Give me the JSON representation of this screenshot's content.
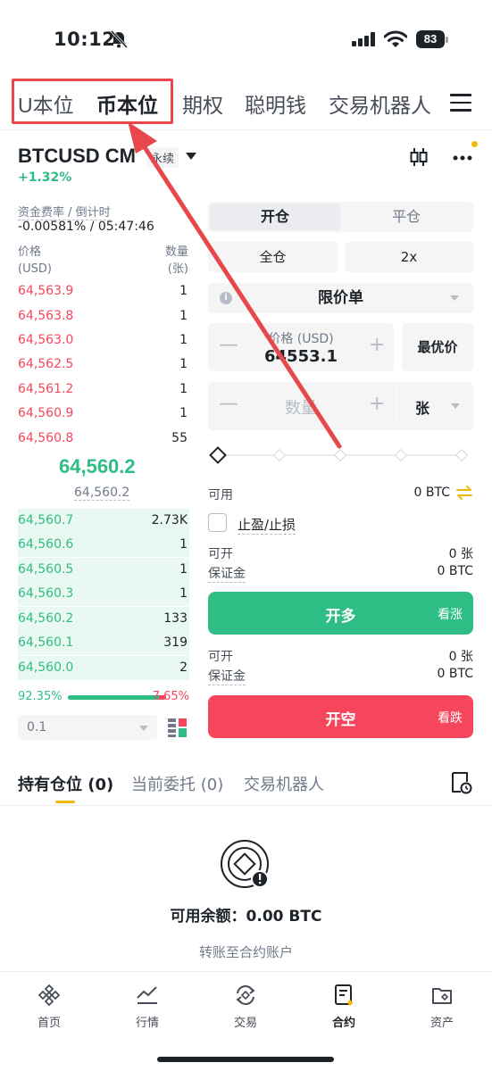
{
  "status_bar": {
    "time": "10:12",
    "battery": "83"
  },
  "top_tabs": [
    "U本位",
    "币本位",
    "期权",
    "聪明钱",
    "交易机器人"
  ],
  "symbol": {
    "name": "BTCUSD CM",
    "badge": "永续",
    "change": "+1.32%"
  },
  "orderbook": {
    "funding_label": "资金费率 / 倒计时",
    "funding_value": "-0.00581% / 05:47:46",
    "price_header": [
      "价格",
      "(USD)"
    ],
    "qty_header": [
      "数量",
      "(张)"
    ],
    "asks": [
      {
        "price": "64,563.9",
        "qty": "1"
      },
      {
        "price": "64,563.8",
        "qty": "1"
      },
      {
        "price": "64,563.0",
        "qty": "1"
      },
      {
        "price": "64,562.5",
        "qty": "1"
      },
      {
        "price": "64,561.2",
        "qty": "1"
      },
      {
        "price": "64,560.9",
        "qty": "1"
      },
      {
        "price": "64,560.8",
        "qty": "55"
      }
    ],
    "last_price": "64,560.2",
    "mark_price": "64,560.2",
    "bids": [
      {
        "price": "64,560.7",
        "qty": "2.73K"
      },
      {
        "price": "64,560.6",
        "qty": "1"
      },
      {
        "price": "64,560.5",
        "qty": "1"
      },
      {
        "price": "64,560.3",
        "qty": "1"
      },
      {
        "price": "64,560.2",
        "qty": "133"
      },
      {
        "price": "64,560.1",
        "qty": "319"
      },
      {
        "price": "64,560.0",
        "qty": "2"
      }
    ],
    "buy_ratio": "92.35%",
    "sell_ratio": "7.65%",
    "buy_ratio_fraction": 0.9235,
    "depth": "0.1"
  },
  "order_form": {
    "open_tab": "开仓",
    "close_tab": "平仓",
    "margin_mode": "全仓",
    "leverage": "2x",
    "order_type": "限价单",
    "price_label": "价格 (USD)",
    "price_value": "64553.1",
    "best_price": "最优价",
    "quantity_placeholder": "数量",
    "unit": "张",
    "available_label": "可用",
    "available_value": "0 BTC",
    "tpsl_label": "止盈/止损",
    "long": {
      "can_open_label": "可开",
      "can_open_value": "0 张",
      "margin_label": "保证金",
      "margin_value": "0 BTC",
      "button": "开多",
      "sub": "看涨"
    },
    "short": {
      "can_open_label": "可开",
      "can_open_value": "0 张",
      "margin_label": "保证金",
      "margin_value": "0 BTC",
      "button": "开空",
      "sub": "看跌"
    }
  },
  "position_tabs": [
    "持有仓位 (0)",
    "当前委托 (0)",
    "交易机器人"
  ],
  "empty_state": {
    "balance": "可用余额：0.00 BTC",
    "transfer": "转账至合约账户"
  },
  "bottom_nav": [
    "首页",
    "行情",
    "交易",
    "合约",
    "资产"
  ],
  "colors": {
    "buy": "#2ebd85",
    "sell": "#f6465d",
    "accent": "#f0b90b",
    "annotation": "#e8474c"
  }
}
